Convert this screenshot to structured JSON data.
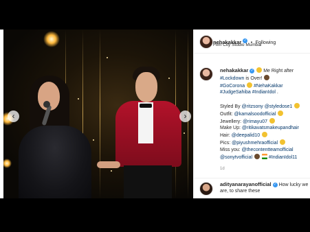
{
  "post": {
    "username": "nehakakkar",
    "follow_label": "Following",
    "location": "Film City Studio Mumbai",
    "time_ago": "1d",
    "caption": {
      "line1": "Me Right after",
      "line2_tag": "#Lockdown",
      "line2_text": " is Over!",
      "line3_tag": "#GoCorona",
      "line3_tag2": "#NehaKakkar",
      "line4_tag": "#JudgeSahiba",
      "line4_tag2": "#IndianIdol",
      "line4_end": " .",
      "styled_by": "Styled By ",
      "styled_tag1": "@ritzsony",
      "styled_tag2": "@styledose1",
      "outfit": "Outfit: ",
      "outfit_tag": "@kamalsoodofficial",
      "jewellery": "Jewellery: ",
      "jewellery_tag": "@rimayu07",
      "makeup": "Make Up: ",
      "makeup_tag": "@ritikavatsmakeupandhair",
      "hair": "Hair: ",
      "hair_tag": "@deepalid10",
      "pics": "Pics: ",
      "pics_tag": "@piyushmehraofficial",
      "miss_you": "Miss you: ",
      "miss_you_tag": "@thecontentteamofficial",
      "sony_tag": "@sonytvofficial",
      "indianidol_tag": "#IndianIdol11"
    },
    "comment": {
      "username": "adityanarayanofficial",
      "text": "How lucky we are, to share these"
    }
  },
  "colors": {
    "link": "#003569",
    "verified": "#3897f0",
    "jacket": "#b3122a"
  }
}
